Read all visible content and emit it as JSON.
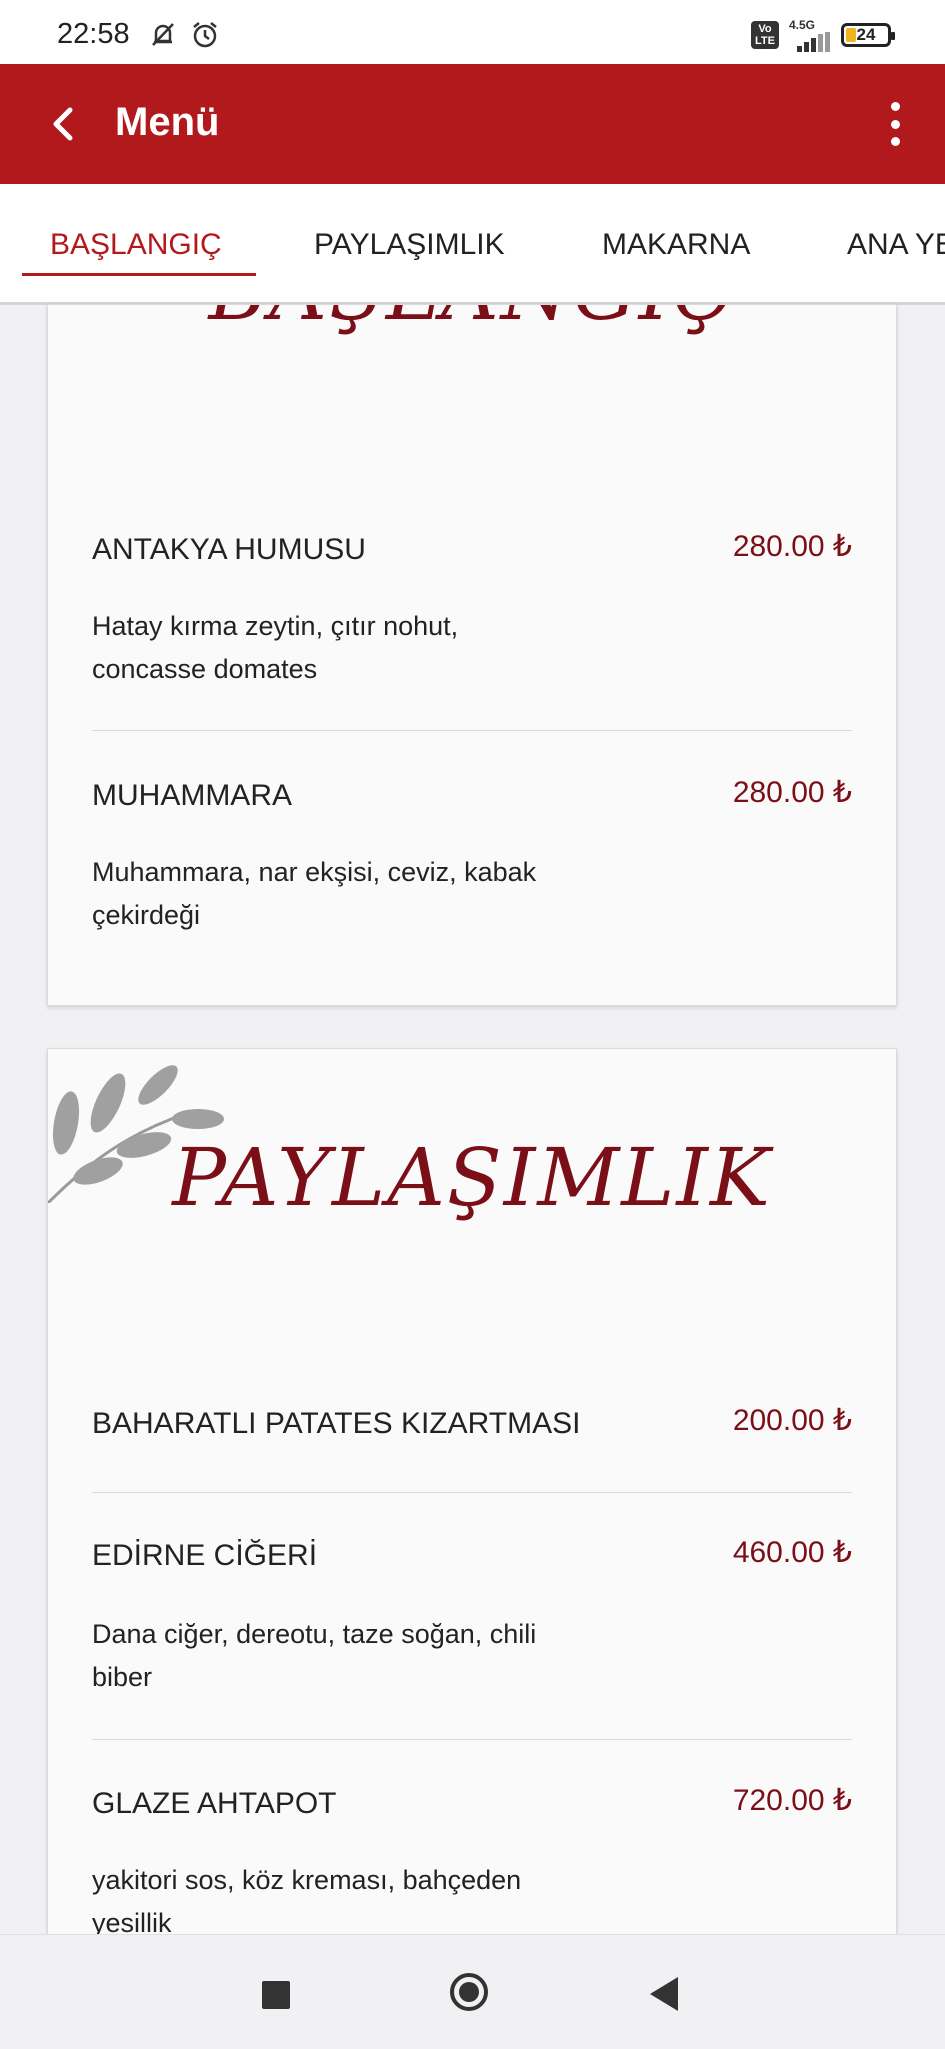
{
  "status": {
    "time": "22:58",
    "network": "4.5G",
    "volte": "Vo LTE",
    "battery": "24"
  },
  "app_bar": {
    "title": "Menü"
  },
  "tabs": [
    {
      "label": "BAŞLANGIÇ",
      "active": true
    },
    {
      "label": "PAYLAŞIMLIK",
      "active": false
    },
    {
      "label": "MAKARNA",
      "active": false
    },
    {
      "label": "ANA YE",
      "active": false
    }
  ],
  "sections": [
    {
      "heading": "BAŞLANGIÇ",
      "items": [
        {
          "name": "ANTAKYA HUMUSU",
          "price": "280.00 ₺",
          "description_line1": "Hatay kırma zeytin, çıtır nohut,",
          "description_line2": "concasse domates"
        },
        {
          "name": "MUHAMMARA",
          "price": "280.00 ₺",
          "description_line1": "Muhammara, nar ekşisi, ceviz, kabak",
          "description_line2": "çekirdeği"
        }
      ]
    },
    {
      "heading": "PAYLAŞIMLIK",
      "items": [
        {
          "name": "BAHARATLI PATATES KIZARTMASI",
          "price": "200.00 ₺"
        },
        {
          "name": "EDİRNE CİĞERİ",
          "price": "460.00 ₺",
          "description_line1": "Dana ciğer, dereotu, taze soğan, chili",
          "description_line2": "biber"
        },
        {
          "name": "GLAZE AHTAPOT",
          "price": "720.00 ₺",
          "description_line1": "yakitori sos, köz kreması, bahçeden",
          "description_line2": "yesillik"
        }
      ]
    }
  ],
  "colors": {
    "primary": "#b1191d",
    "price": "#7b0f17",
    "heading": "#7b0f17"
  }
}
